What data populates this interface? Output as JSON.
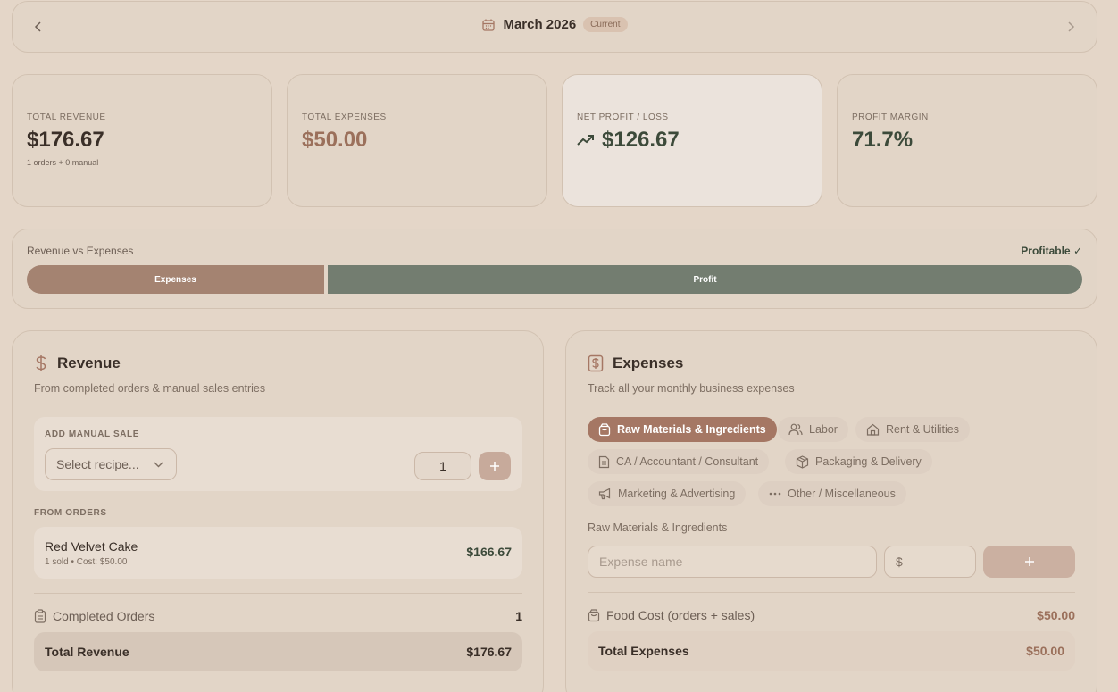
{
  "month_bar": {
    "month": "March 2026",
    "badge": "Current"
  },
  "stats": {
    "revenue": {
      "label": "TOTAL REVENUE",
      "value": "$176.67",
      "sub": "1 orders + 0 manual"
    },
    "expenses": {
      "label": "TOTAL EXPENSES",
      "value": "$50.00"
    },
    "net": {
      "label": "NET PROFIT / LOSS",
      "value": "$126.67"
    },
    "margin": {
      "label": "PROFIT MARGIN",
      "value": "71.7%"
    }
  },
  "rve": {
    "title": "Revenue vs Expenses",
    "status": "Profitable ✓",
    "expenses_label": "Expenses",
    "profit_label": "Profit",
    "expenses_fraction": 0.283
  },
  "revenue": {
    "title": "Revenue",
    "subtitle": "From completed orders & manual sales entries",
    "manual_label": "ADD MANUAL SALE",
    "select_placeholder": "Select recipe...",
    "quantity": "1",
    "orders_label": "FROM ORDERS",
    "orders": [
      {
        "name": "Red Velvet Cake",
        "meta": "1 sold • Cost: $50.00",
        "amount": "$166.67"
      }
    ],
    "completed_label": "Completed Orders",
    "completed_count": "1",
    "total_label": "Total Revenue",
    "total_value": "$176.67"
  },
  "expenses": {
    "title": "Expenses",
    "subtitle": "Track all your monthly business expenses",
    "categories": [
      {
        "label": "Raw Materials & Ingredients",
        "icon": "shopping-bag-icon",
        "active": true
      },
      {
        "label": "Labor",
        "icon": "users-icon",
        "active": false
      },
      {
        "label": "Rent & Utilities",
        "icon": "home-icon",
        "active": false
      },
      {
        "label": "CA / Accountant / Consultant",
        "icon": "document-icon",
        "active": false
      },
      {
        "label": "Packaging & Delivery",
        "icon": "package-icon",
        "active": false
      },
      {
        "label": "Marketing & Advertising",
        "icon": "megaphone-icon",
        "active": false
      },
      {
        "label": "Other / Miscellaneous",
        "icon": "more-icon",
        "active": false
      }
    ],
    "selected_category": "Raw Materials & Ingredients",
    "name_placeholder": "Expense name",
    "currency_symbol": "$",
    "food_cost_label": "Food Cost (orders + sales)",
    "food_cost_value": "$50.00",
    "total_label": "Total Expenses",
    "total_value": "$50.00"
  },
  "colors": {
    "background": "#e4d6c8",
    "expenses_accent": "#a48371",
    "profit_accent": "#737d70",
    "profit_text": "#3c4a3a",
    "active_chip": "#a57764"
  }
}
